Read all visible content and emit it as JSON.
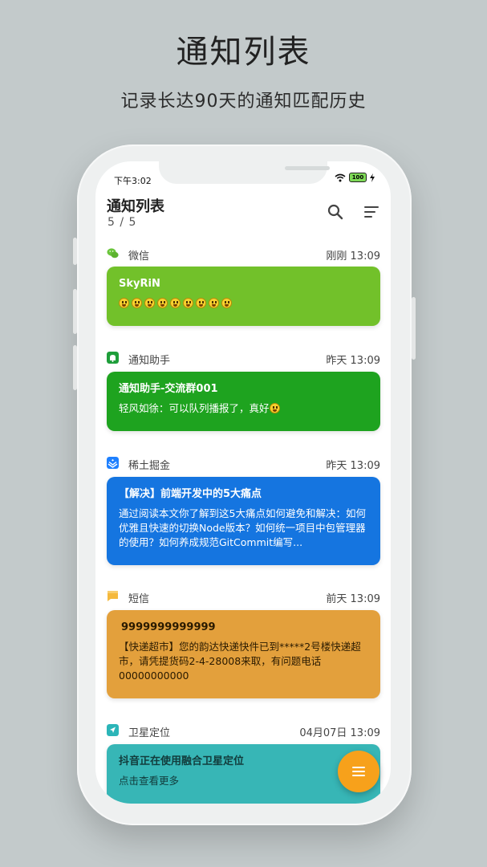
{
  "hero": {
    "title": "通知列表",
    "subtitle": "记录长达90天的通知匹配历史"
  },
  "status_bar": {
    "time": "下午3:02",
    "battery": "100"
  },
  "header": {
    "title": "通知列表",
    "count": "5 / 5",
    "search_icon": "search-icon",
    "sort_icon": "sort-icon"
  },
  "notifications": [
    {
      "app": "微信",
      "time": "刚刚 13:09",
      "icon": "wechat-icon",
      "icon_color": "#6ac53b",
      "card_color": "#72c12a",
      "title": "SkyRiN",
      "body": "",
      "emoji_count": 9
    },
    {
      "app": "通知助手",
      "time": "昨天 13:09",
      "icon": "notification-helper-icon",
      "icon_color": "#1e9e3a",
      "card_color": "#1ea31f",
      "title": "通知助手-交流群001",
      "body": "轻风如徐：可以队列播报了，真好",
      "emoji_count": 1
    },
    {
      "app": "稀土掘金",
      "time": "昨天 13:09",
      "icon": "juejin-icon",
      "icon_color": "#1e80ff",
      "card_color": "#1575e0",
      "title": "【解决】前端开发中的5大痛点",
      "body": "通过阅读本文你了解到这5大痛点如何避免和解决：如何优雅且快速的切换Node版本？如何统一项目中包管理器的使用？如何养成规范GitCommit编写...",
      "emoji_count": 0
    },
    {
      "app": "短信",
      "time": "前天 13:09",
      "icon": "sms-icon",
      "icon_color": "#f5b93d",
      "card_color": "#e3a03c",
      "title": "9999999999999",
      "body": "【快递超市】您的韵达快递快件已到*****2号楼快递超市，请凭提货码2-4-28008来取，有问题电话00000000000",
      "emoji_count": 0
    },
    {
      "app": "卫星定位",
      "time": "04月07日 13:09",
      "icon": "location-icon",
      "icon_color": "#2bb5b8",
      "card_color": "#37b6b6",
      "title": "抖音正在使用融合卫星定位",
      "body": "点击查看更多",
      "emoji_count": 0
    }
  ],
  "fab": {
    "icon": "menu-icon",
    "color": "#f7a11b"
  }
}
